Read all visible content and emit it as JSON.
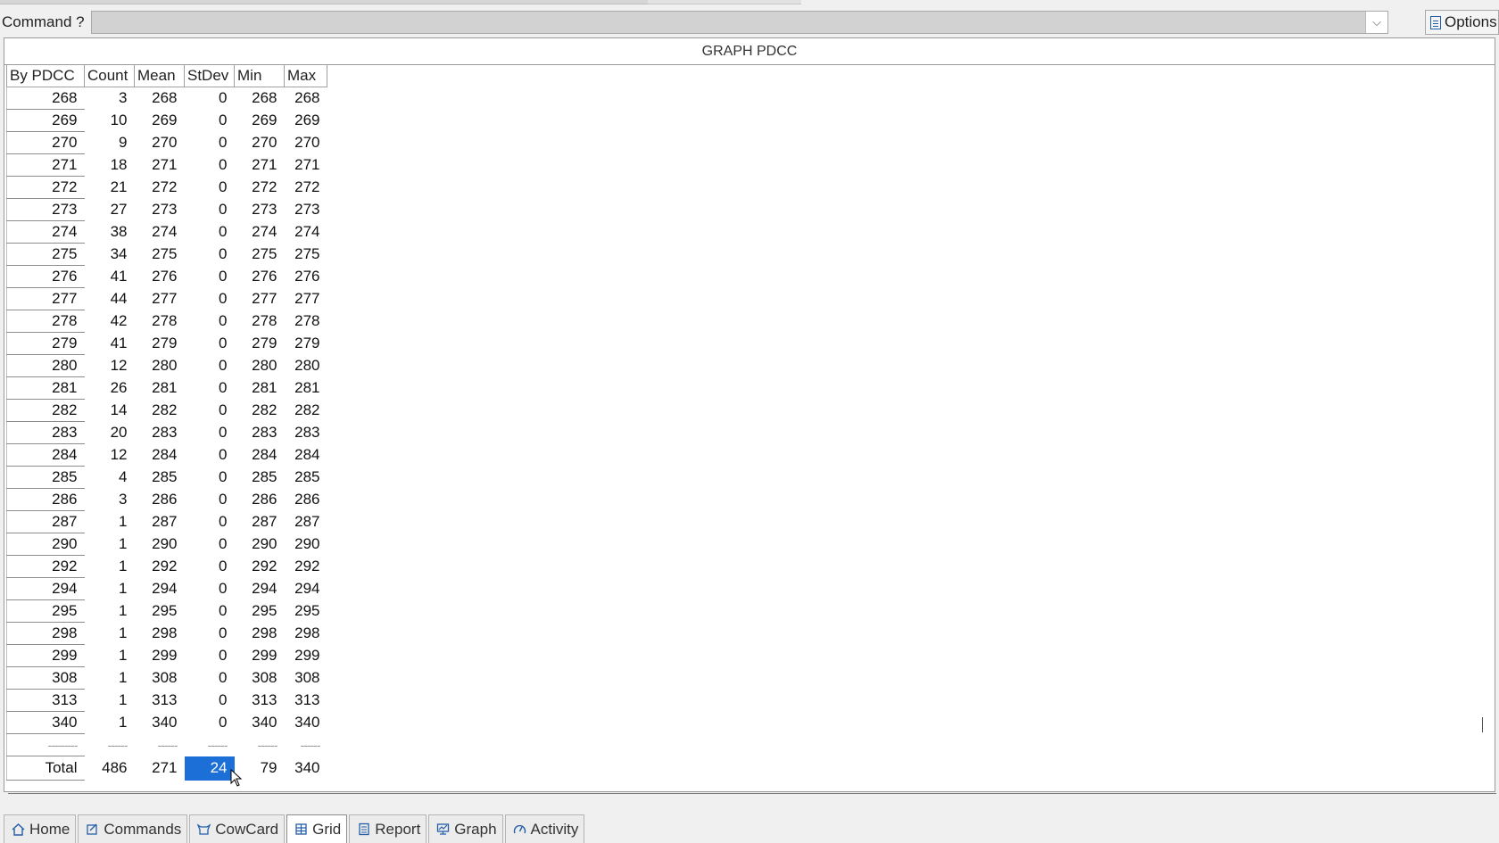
{
  "command_bar": {
    "label": "Command ?",
    "value": "",
    "options_label": "Options"
  },
  "panel": {
    "title": "GRAPH PDCC"
  },
  "grid": {
    "columns": [
      "By PDCC",
      "Count",
      "Mean",
      "StDev",
      "Min",
      "Max"
    ],
    "rows": [
      [
        "268",
        "3",
        "268",
        "0",
        "268",
        "268"
      ],
      [
        "269",
        "10",
        "269",
        "0",
        "269",
        "269"
      ],
      [
        "270",
        "9",
        "270",
        "0",
        "270",
        "270"
      ],
      [
        "271",
        "18",
        "271",
        "0",
        "271",
        "271"
      ],
      [
        "272",
        "21",
        "272",
        "0",
        "272",
        "272"
      ],
      [
        "273",
        "27",
        "273",
        "0",
        "273",
        "273"
      ],
      [
        "274",
        "38",
        "274",
        "0",
        "274",
        "274"
      ],
      [
        "275",
        "34",
        "275",
        "0",
        "275",
        "275"
      ],
      [
        "276",
        "41",
        "276",
        "0",
        "276",
        "276"
      ],
      [
        "277",
        "44",
        "277",
        "0",
        "277",
        "277"
      ],
      [
        "278",
        "42",
        "278",
        "0",
        "278",
        "278"
      ],
      [
        "279",
        "41",
        "279",
        "0",
        "279",
        "279"
      ],
      [
        "280",
        "12",
        "280",
        "0",
        "280",
        "280"
      ],
      [
        "281",
        "26",
        "281",
        "0",
        "281",
        "281"
      ],
      [
        "282",
        "14",
        "282",
        "0",
        "282",
        "282"
      ],
      [
        "283",
        "20",
        "283",
        "0",
        "283",
        "283"
      ],
      [
        "284",
        "12",
        "284",
        "0",
        "284",
        "284"
      ],
      [
        "285",
        "4",
        "285",
        "0",
        "285",
        "285"
      ],
      [
        "286",
        "3",
        "286",
        "0",
        "286",
        "286"
      ],
      [
        "287",
        "1",
        "287",
        "0",
        "287",
        "287"
      ],
      [
        "290",
        "1",
        "290",
        "0",
        "290",
        "290"
      ],
      [
        "292",
        "1",
        "292",
        "0",
        "292",
        "292"
      ],
      [
        "294",
        "1",
        "294",
        "0",
        "294",
        "294"
      ],
      [
        "295",
        "1",
        "295",
        "0",
        "295",
        "295"
      ],
      [
        "298",
        "1",
        "298",
        "0",
        "298",
        "298"
      ],
      [
        "299",
        "1",
        "299",
        "0",
        "299",
        "299"
      ],
      [
        "308",
        "1",
        "308",
        "0",
        "308",
        "308"
      ],
      [
        "313",
        "1",
        "313",
        "0",
        "313",
        "313"
      ],
      [
        "340",
        "1",
        "340",
        "0",
        "340",
        "340"
      ]
    ],
    "separator": [
      "---------",
      "------",
      "------",
      "------",
      "------",
      "------"
    ],
    "total": [
      "Total",
      "486",
      "271",
      "24",
      "79",
      "340"
    ],
    "selected_cell": "total.StDev"
  },
  "tabs": [
    {
      "label": "Home",
      "icon": "home-icon"
    },
    {
      "label": "Commands",
      "icon": "commands-icon"
    },
    {
      "label": "CowCard",
      "icon": "cowcard-icon"
    },
    {
      "label": "Grid",
      "icon": "grid-icon",
      "active": true
    },
    {
      "label": "Report",
      "icon": "report-icon"
    },
    {
      "label": "Graph",
      "icon": "graph-icon"
    },
    {
      "label": "Activity",
      "icon": "activity-icon"
    }
  ],
  "colors": {
    "selection": "#1c6fd6",
    "icon_blue": "#245ea8"
  }
}
